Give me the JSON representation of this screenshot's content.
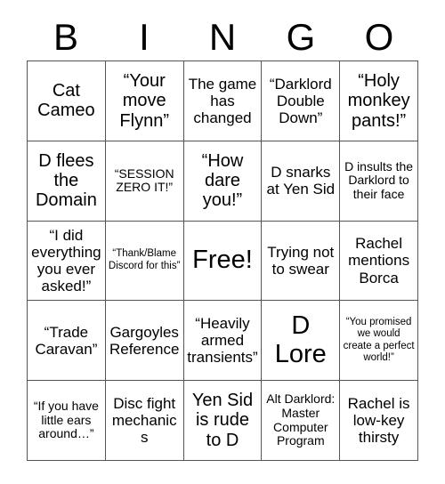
{
  "card": {
    "title": "BINGO",
    "header_letters": [
      "B",
      "I",
      "N",
      "G",
      "O"
    ],
    "rows": [
      [
        {
          "text": "Cat Cameo",
          "size": "lg"
        },
        {
          "text": "“Your move Flynn”",
          "size": "lg"
        },
        {
          "text": "The game has changed",
          "size": "md"
        },
        {
          "text": "“Darklord Double Down”",
          "size": "md"
        },
        {
          "text": "“Holy monkey pants!”",
          "size": "lg"
        }
      ],
      [
        {
          "text": "D flees the Domain",
          "size": "lg"
        },
        {
          "text": "“SESSION ZERO IT!”",
          "size": "sm"
        },
        {
          "text": "“How dare you!”",
          "size": "lg"
        },
        {
          "text": "D snarks at Yen Sid",
          "size": "md"
        },
        {
          "text": "D insults the Darklord to their face",
          "size": "sm"
        }
      ],
      [
        {
          "text": "“I did everything you ever asked!”",
          "size": "md"
        },
        {
          "text": "“Thank/Blame Discord for this”",
          "size": "xs"
        },
        {
          "text": "Free!",
          "size": "xl"
        },
        {
          "text": "Trying not to swear",
          "size": "md"
        },
        {
          "text": "Rachel mentions Borca",
          "size": "md"
        }
      ],
      [
        {
          "text": "“Trade Caravan”",
          "size": "md"
        },
        {
          "text": "Gargoyles Reference",
          "size": "md"
        },
        {
          "text": "“Heavily armed transients”",
          "size": "md"
        },
        {
          "text": "D Lore",
          "size": "xl"
        },
        {
          "text": "“You promised we would create a perfect world!”",
          "size": "xs"
        }
      ],
      [
        {
          "text": "“If you have little ears around…”",
          "size": "sm"
        },
        {
          "text": "Disc fight mechanics",
          "size": "md"
        },
        {
          "text": "Yen Sid is rude to D",
          "size": "lg"
        },
        {
          "text": "Alt Darklord: Master Computer Program",
          "size": "sm"
        },
        {
          "text": "Rachel is low-key thirsty",
          "size": "md"
        }
      ]
    ]
  },
  "colors": {
    "background": "#ffffff",
    "text": "#000000",
    "grid_line": "#555555"
  }
}
